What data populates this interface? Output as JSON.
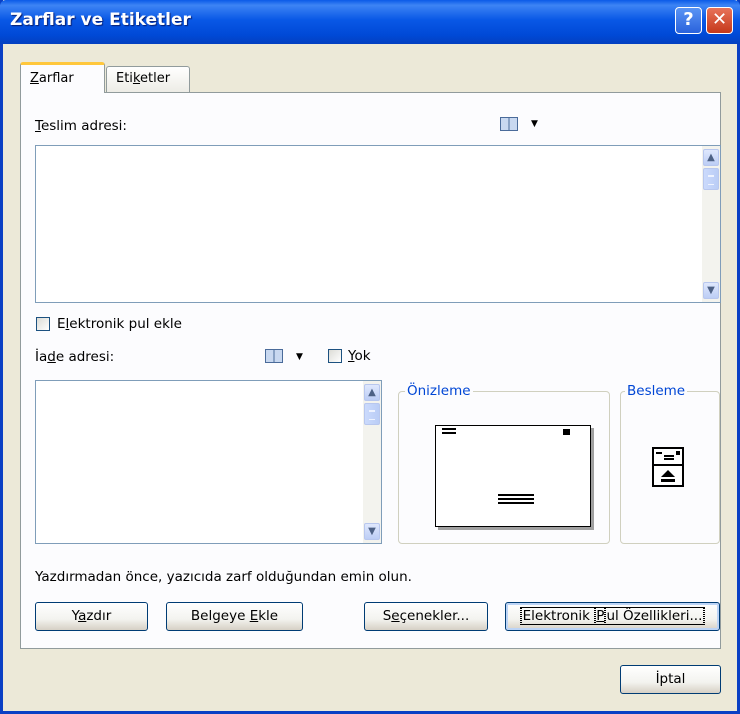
{
  "window": {
    "title": "Zarflar ve Etiketler"
  },
  "title_buttons": {
    "help": "?",
    "close": "✕"
  },
  "tabs": [
    {
      "label": "Zarflar",
      "accel": "Z",
      "rest": "arflar",
      "active": true
    },
    {
      "label": "Etiketler",
      "pre": "Eti",
      "accel": "k",
      "rest": "etler",
      "active": false
    }
  ],
  "delivery": {
    "accel": "T",
    "rest": "eslim adresi:",
    "value": "",
    "icon": "address-book-icon"
  },
  "epostage": {
    "pre": "E",
    "accel": "l",
    "rest": "ektronik pul ekle",
    "checked": false
  },
  "return_address": {
    "pre": "İa",
    "accel": "d",
    "rest": "e adresi:",
    "value": "",
    "icon": "address-book-icon"
  },
  "omit": {
    "accel": "Y",
    "rest": "ok",
    "checked": false
  },
  "preview": {
    "label": "Önizleme"
  },
  "feed": {
    "label": "Besleme"
  },
  "notice": "Yazdırmadan önce, yazıcıda zarf olduğundan emin olun.",
  "buttons": {
    "print": {
      "pre": "Y",
      "accel": "a",
      "rest": "zdır"
    },
    "add_to_doc": {
      "pre": "Belgeye ",
      "accel": "E",
      "rest": "kle"
    },
    "options": {
      "pre": "S",
      "accel": "e",
      "rest": "çenekler..."
    },
    "epostage_props": {
      "pre": "Elektronik ",
      "accel": "P",
      "rest": "ul Özellikleri..."
    },
    "cancel": {
      "label": "İptal"
    }
  },
  "colors": {
    "title_blue": "#0a5ae8",
    "legend_blue": "#0046d5",
    "tab_accent": "#ffc73c",
    "close_red": "#c5381a"
  }
}
